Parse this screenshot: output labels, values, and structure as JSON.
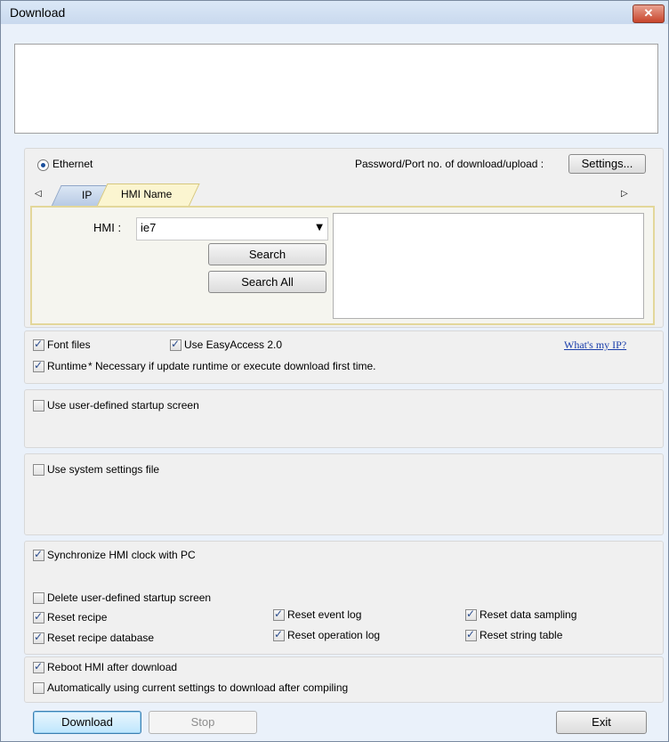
{
  "window": {
    "title": "Download"
  },
  "connection": {
    "ethernet_label": "Ethernet",
    "password_label": "Password/Port no. of download/upload :",
    "settings_button": "Settings...",
    "tabs": [
      {
        "label": "IP"
      },
      {
        "label": "HMI Name"
      }
    ],
    "tab_left_arrow": "◁",
    "tab_right_arrow": "▷",
    "hmi_label": "HMI :",
    "hmi_value": "ie7",
    "search_button": "Search",
    "search_all_button": "Search All"
  },
  "options": {
    "font_files": "Font files",
    "use_easyaccess": "Use EasyAccess 2.0",
    "whats_my_ip": "What's my IP?",
    "runtime": "Runtime",
    "runtime_note": "* Necessary if update runtime or execute download first time."
  },
  "startup": {
    "use_user_defined": "Use user-defined startup screen"
  },
  "system": {
    "use_system_settings": "Use system settings file"
  },
  "clock": {
    "sync_clock": "Synchronize HMI clock with PC",
    "delete_startup": "Delete user-defined startup screen",
    "reset_recipe": "Reset recipe",
    "reset_recipe_db": "Reset recipe database",
    "reset_event_log": "Reset event log",
    "reset_operation_log": "Reset operation log",
    "reset_data_sampling": "Reset data sampling",
    "reset_string_table": "Reset string table"
  },
  "reboot": {
    "reboot_after": "Reboot HMI after download",
    "auto_download": "Automatically using current settings to download after compiling"
  },
  "footer": {
    "download": "Download",
    "stop": "Stop",
    "exit": "Exit"
  }
}
